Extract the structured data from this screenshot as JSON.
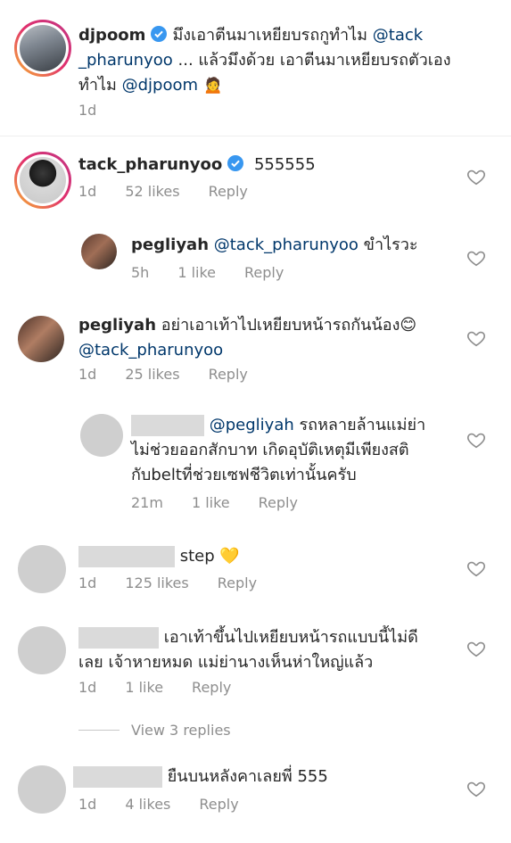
{
  "comments": [
    {
      "username": "djpoom",
      "text": "มึงเอาตีนมาเหยียบรถกูทำไม @tack _pharunyoo ... แล้วมึงด้วย เอาตีนมาเหยียบรถตัวเอง ทำไม @djpoom",
      "text_line1_a": "มึงเอาตีนมาเหยียบรถกูทำไม",
      "text_line1_mention": "@tack",
      "text_line2_mention": "_pharunyoo",
      "text_line2_b": "... แล้วมึงด้วย เอาตีนมาเหยียบรถตัวเอง",
      "text_line3_a": "ทำไม",
      "text_line3_mention": "@djpoom",
      "emoji": "🙍",
      "time": "1d"
    },
    {
      "username": "tack_pharunyoo",
      "text": "555555",
      "time": "1d",
      "likes": "52 likes",
      "reply": "Reply"
    },
    {
      "username": "pegliyah",
      "mention": "@tack_pharunyoo",
      "text": "ขำไรวะ",
      "time": "5h",
      "likes": "1 like",
      "reply": "Reply"
    },
    {
      "username": "pegliyah",
      "text": "อย่าเอาเท้าไปเหยียบหน้ารถกันน้อง😊",
      "mention": "@tack_pharunyoo",
      "time": "1d",
      "likes": "25 likes",
      "reply": "Reply"
    },
    {
      "mention": "@pegliyah",
      "text_line1": "รถหลายล้านแม่ย่า",
      "text_line2": "ไม่ช่วยออกสักบาท เกิดอุบัติเหตุมีเพียงสติ",
      "text_line3": "กับbeltที่ช่วยเซฟชีวิตเท่านั้นครับ",
      "time": "21m",
      "likes": "1 like",
      "reply": "Reply"
    },
    {
      "text": "step 💛",
      "time": "1d",
      "likes": "125 likes",
      "reply": "Reply"
    },
    {
      "text_line1": "เอาเท้าขึ้นไปเหยียบหน้ารถแบบนี้ไม่ดี",
      "text_line2": "เลย เจ้าหายหมด แม่ย่านางเห็นห่าใหญ่แล้ว",
      "time": "1d",
      "likes": "1 like",
      "reply": "Reply"
    },
    {
      "text": "ยืนบนหลังคาเลยพี่ 555",
      "time": "1d",
      "likes": "4 likes",
      "reply": "Reply"
    }
  ],
  "view_replies": "View 3 replies",
  "colors": {
    "mention": "#00376b",
    "meta": "#8e8e8e",
    "verified": "#3897f0"
  }
}
